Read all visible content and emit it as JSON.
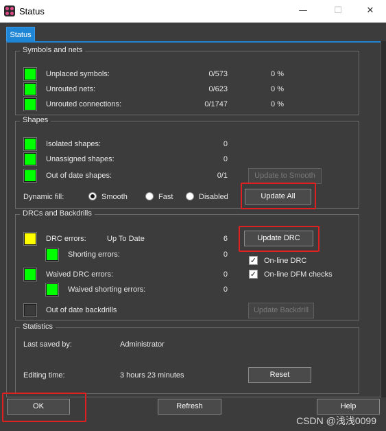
{
  "window": {
    "title": "Status",
    "minimize": "—",
    "maximize": "☐",
    "close": "✕"
  },
  "tab": {
    "label": "Status"
  },
  "symbols_nets": {
    "title": "Symbols and nets",
    "rows": [
      {
        "label": "Unplaced symbols:",
        "count": "0/573",
        "pct": "0 %",
        "status": "green"
      },
      {
        "label": "Unrouted nets:",
        "count": "0/623",
        "pct": "0 %",
        "status": "green"
      },
      {
        "label": "Unrouted connections:",
        "count": "0/1747",
        "pct": "0 %",
        "status": "green"
      }
    ]
  },
  "shapes": {
    "title": "Shapes",
    "rows": [
      {
        "label": "Isolated shapes:",
        "count": "0",
        "status": "green"
      },
      {
        "label": "Unassigned shapes:",
        "count": "0",
        "status": "green"
      },
      {
        "label": "Out of date shapes:",
        "count": "0/1",
        "status": "green"
      }
    ],
    "update_to_smooth": "Update to Smooth",
    "dynamic_fill_label": "Dynamic fill:",
    "fill_options": [
      "Smooth",
      "Fast",
      "Disabled"
    ],
    "fill_selected": "Smooth",
    "update_all": "Update All"
  },
  "drcs": {
    "title": "DRCs and Backdrills",
    "drc_errors_label": "DRC errors:",
    "drc_state": "Up To Date",
    "drc_errors_count": "6",
    "shorting_label": "Shorting errors:",
    "shorting_count": "0",
    "waived_label": "Waived DRC errors:",
    "waived_count": "0",
    "waived_shorting_label": "Waived shorting errors:",
    "waived_shorting_count": "0",
    "backdrills_label": "Out of date backdrills",
    "update_drc": "Update DRC",
    "online_drc": "On-line DRC",
    "online_dfm": "On-line DFM checks",
    "update_backdrill": "Update Backdrill"
  },
  "statistics": {
    "title": "Statistics",
    "last_saved_label": "Last saved by:",
    "last_saved_value": "Administrator",
    "editing_time_label": "Editing time:",
    "editing_time_value": "3 hours 23 minutes",
    "reset": "Reset"
  },
  "footer": {
    "ok": "OK",
    "refresh": "Refresh",
    "help": "Help"
  },
  "watermark": "CSDN @浅浅0099",
  "colors": {
    "accent": "#1f86d6",
    "ok_status": "#00ff00",
    "warn_status": "#ffff00",
    "highlight": "#e02020"
  }
}
